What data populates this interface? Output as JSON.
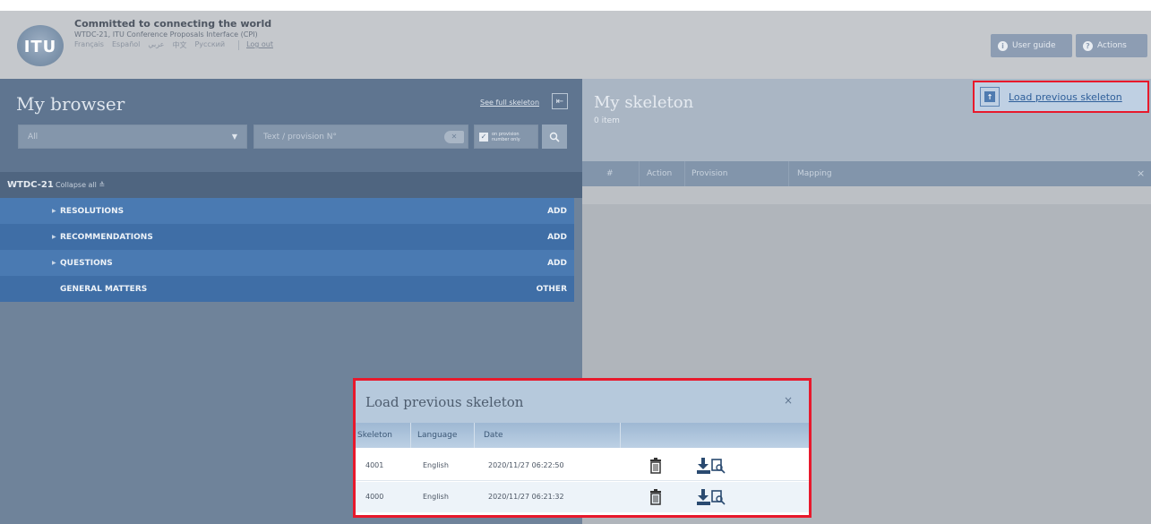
{
  "header": {
    "logo_text": "ITU",
    "title": "Committed to connecting the world",
    "subtitle": "WTDC-21, ITU Conference Proposals Interface (CPI)",
    "languages": [
      "Français",
      "Español",
      "عربي",
      "中文",
      "Русский"
    ],
    "logout_label": "Log out",
    "user_guide_label": "User guide",
    "actions_label": "Actions"
  },
  "browser": {
    "title": "My browser",
    "see_full_skeleton_label": "See full skeleton",
    "select_value": "All",
    "text_placeholder": "Text / provision N°",
    "checkbox_label": "on provision number only",
    "group_name": "WTDC-21",
    "collapse_all_label": "Collapse all",
    "rows": [
      {
        "label": "RESOLUTIONS",
        "action": "ADD"
      },
      {
        "label": "RECOMMENDATIONS",
        "action": "ADD"
      },
      {
        "label": "QUESTIONS",
        "action": "ADD"
      },
      {
        "label": "GENERAL MATTERS",
        "action": "OTHER"
      }
    ]
  },
  "skeleton": {
    "title": "My skeleton",
    "count_label": "0 item",
    "load_previous_label": "Load previous skeleton",
    "columns": [
      "#",
      "Action",
      "Provision",
      "Mapping"
    ],
    "close_glyph": "×"
  },
  "modal": {
    "title": "Load previous skeleton",
    "close_glyph": "×",
    "columns": [
      "Skeleton",
      "Language",
      "Date"
    ],
    "rows": [
      {
        "skeleton": "4001",
        "language": "English",
        "date": "2020/11/27 06:22:50"
      },
      {
        "skeleton": "4000",
        "language": "English",
        "date": "2020/11/27 06:21:32"
      }
    ]
  },
  "colors": {
    "accent_blue": "#4a7ab2",
    "highlight_red": "#e8192c",
    "panel_slate": "#6f839a"
  },
  "icons": {
    "info": "info-icon",
    "help": "help-icon",
    "search": "search-icon",
    "upload": "upload-icon",
    "trash": "trash-icon",
    "download": "download-icon"
  }
}
